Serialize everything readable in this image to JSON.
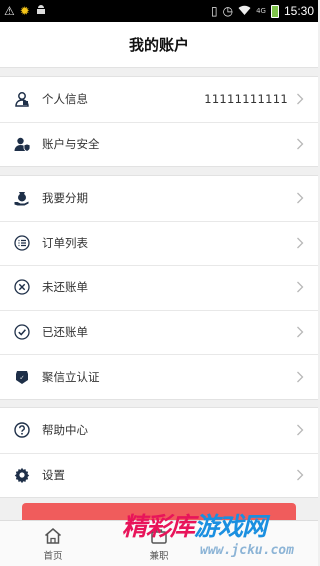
{
  "status_bar": {
    "time": "15:30",
    "left_icons": [
      "warning-icon",
      "sun-icon",
      "android-icon"
    ],
    "right_icons": [
      "vibrate-icon",
      "alarm-icon",
      "wifi-icon",
      "signal-icon",
      "battery-icon"
    ],
    "signal_text": "4G"
  },
  "header": {
    "title": "我的账户"
  },
  "group1": {
    "items": [
      {
        "label": "个人信息",
        "value": "11111111111",
        "icon": "user-icon"
      },
      {
        "label": "账户与安全",
        "icon": "user-shield-icon"
      }
    ]
  },
  "group2": {
    "items": [
      {
        "label": "我要分期",
        "icon": "hand-money-icon"
      },
      {
        "label": "订单列表",
        "icon": "list-icon"
      },
      {
        "label": "未还账单",
        "icon": "close-circle-icon"
      },
      {
        "label": "已还账单",
        "icon": "check-circle-icon"
      },
      {
        "label": "聚信立认证",
        "icon": "badge-icon"
      }
    ]
  },
  "group3": {
    "items": [
      {
        "label": "帮助中心",
        "icon": "help-icon"
      },
      {
        "label": "设置",
        "icon": "gear-icon"
      }
    ]
  },
  "bottom_nav": {
    "items": [
      {
        "label": "首页",
        "icon": "home-icon"
      },
      {
        "label": "兼职",
        "icon": "job-icon"
      }
    ]
  },
  "watermark": {
    "text_a": "精彩库",
    "text_b": "游戏网",
    "url": "www.jcku.com"
  },
  "colors": {
    "icon": "#1e2f48",
    "accent_red": "#f05c5c",
    "background": "#f0f0f0"
  }
}
